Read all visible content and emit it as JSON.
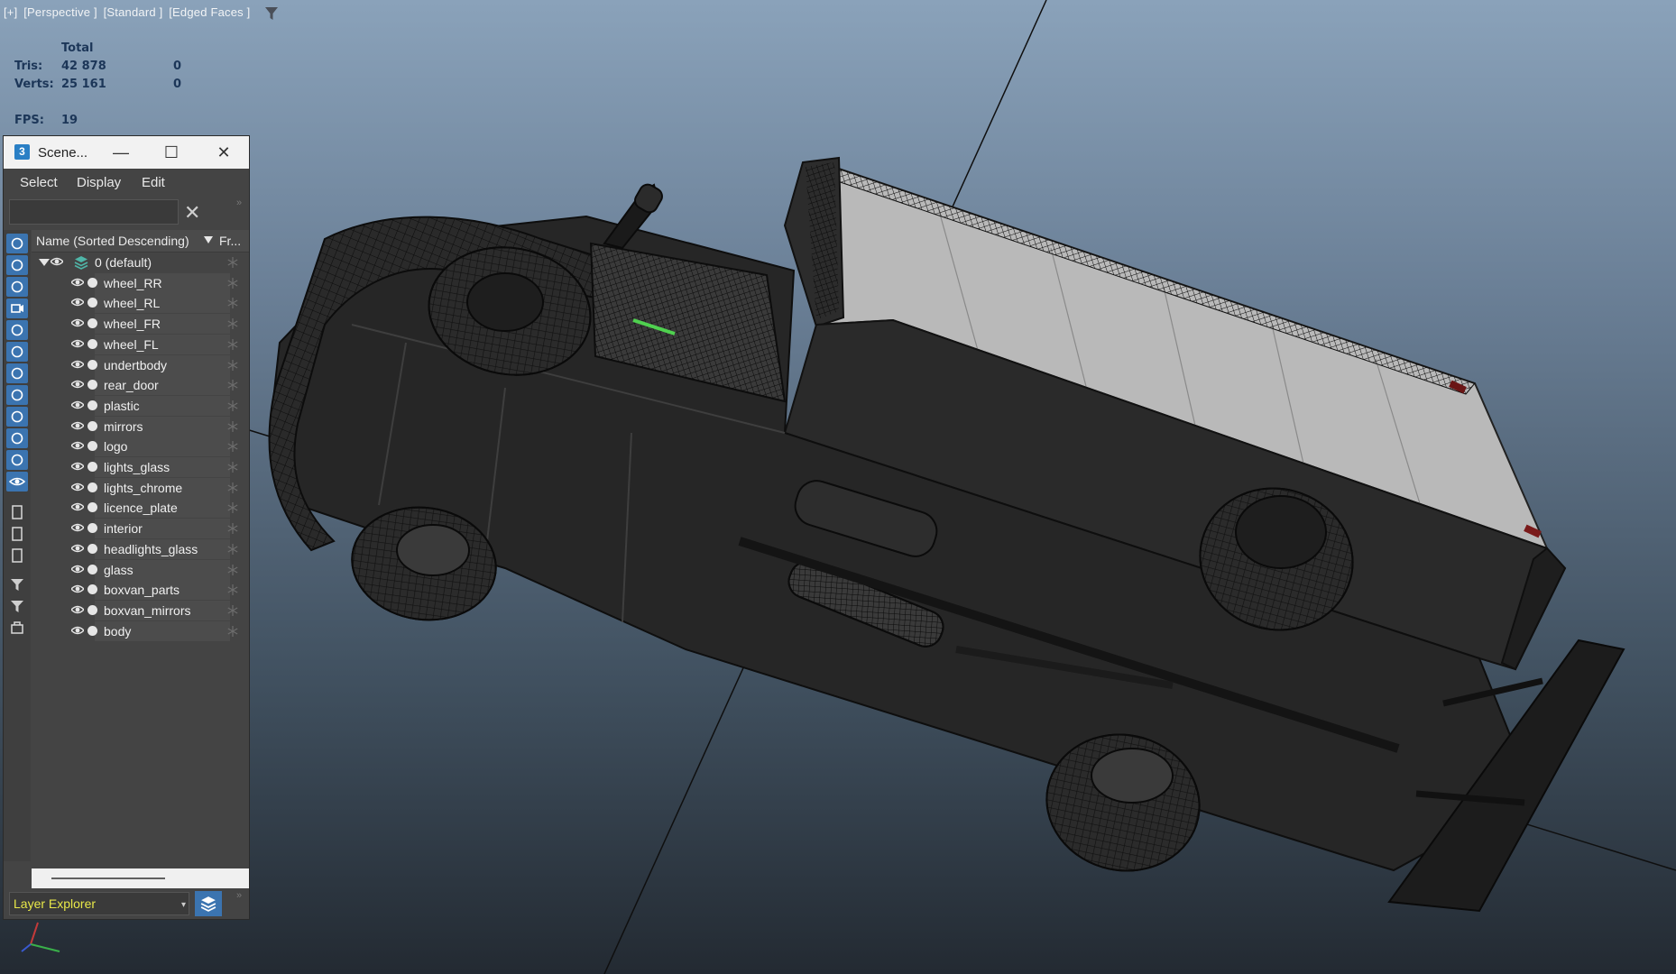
{
  "viewport": {
    "label_parts": [
      "[+]",
      "[Perspective ]",
      "[Standard ]",
      "[Edged Faces ]"
    ],
    "filter_icon": "funnel-icon"
  },
  "stats": {
    "total_header": "Total",
    "tris_label": "Tris:",
    "tris_total": "42 878",
    "tris_selected": "0",
    "verts_label": "Verts:",
    "verts_total": "25 161",
    "verts_selected": "0",
    "fps_label": "FPS:",
    "fps_value": "19"
  },
  "scene_explorer": {
    "app_icon_text": "3",
    "title": "Scene...",
    "minimize": "—",
    "maximize": "☐",
    "close": "✕",
    "menu": [
      "Select",
      "Display",
      "Edit"
    ],
    "search_value": "",
    "clear_icon": "✕",
    "more_glyph": "»",
    "column_name": "Name (Sorted Descending)",
    "column_frozen": "Fr...",
    "root_layer": "0 (default)",
    "objects": [
      "wheel_RR",
      "wheel_RL",
      "wheel_FR",
      "wheel_FL",
      "undertbody",
      "rear_door",
      "plastic",
      "mirrors",
      "logo",
      "lights_glass",
      "lights_chrome",
      "licence_plate",
      "interior",
      "headlights_glass",
      "glass",
      "boxvan_parts",
      "boxvan_mirrors",
      "body"
    ],
    "toolbar_icons": [
      "display-geometry-icon",
      "display-shapes-icon",
      "display-lights-icon",
      "display-cameras-icon",
      "display-helpers-icon",
      "display-spacewarps-icon",
      "display-groups-icon",
      "display-xrefs-icon",
      "display-bones-icon",
      "display-containers-icon",
      "display-frozen-icon",
      "display-hidden-icon",
      "display-all-icon",
      "display-none-icon",
      "invert-display-icon",
      "filter-options-icon",
      "filter-icon",
      "layer-manager-icon"
    ],
    "layer_explorer_label": "Layer Explorer",
    "dropdown_arrow": "▾"
  },
  "colors": {
    "viewport_top": "#8aa2ba",
    "viewport_bottom": "#232a32",
    "stats_text": "#1c3658",
    "panel_bg": "#444444",
    "accent_blue": "#3b74b0",
    "layer_label_yellow": "#e8e849",
    "selection_green": "#4fd14f"
  }
}
